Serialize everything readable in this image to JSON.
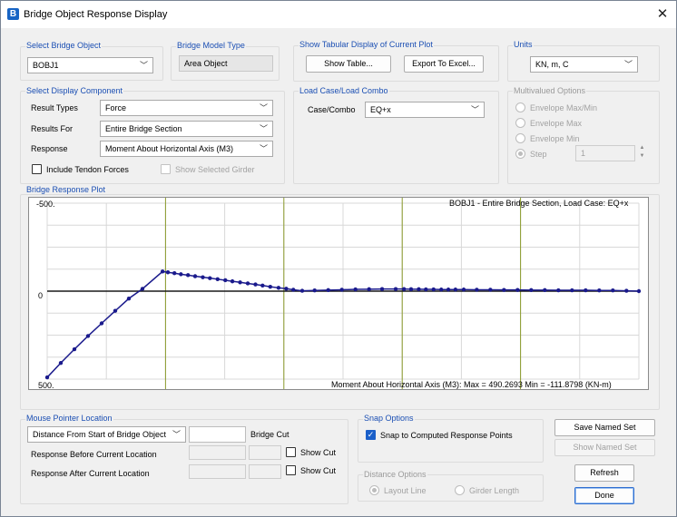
{
  "window": {
    "title": "Bridge Object Response Display",
    "app_icon": "B",
    "close_icon": "✕"
  },
  "select_bridge_object": {
    "label": "Select Bridge Object",
    "value": "BOBJ1"
  },
  "bridge_model_type": {
    "label": "Bridge Model Type",
    "value": "Area Object"
  },
  "tabular": {
    "label": "Show Tabular Display of Current Plot",
    "show_table": "Show Table...",
    "export_excel": "Export To Excel..."
  },
  "units": {
    "label": "Units",
    "value": "KN, m, C"
  },
  "display_component": {
    "label": "Select Display Component",
    "result_types_label": "Result Types",
    "result_types_value": "Force",
    "results_for_label": "Results For",
    "results_for_value": "Entire Bridge Section",
    "response_label": "Response",
    "response_value": "Moment About Horizontal Axis  (M3)",
    "include_tendon": "Include Tendon Forces",
    "show_selected_girder": "Show Selected Girder"
  },
  "load_case": {
    "label": "Load Case/Load Combo",
    "case_label": "Case/Combo",
    "case_value": "EQ+x"
  },
  "multivalued": {
    "label": "Multivalued Options",
    "env_maxmin": "Envelope Max/Min",
    "env_max": "Envelope Max",
    "env_min": "Envelope Min",
    "step": "Step",
    "step_value": "1"
  },
  "plot": {
    "label": "Bridge Response Plot",
    "header": "BOBJ1 - Entire Bridge Section,  Load Case: EQ+x",
    "footer": "Moment About Horizontal Axis  (M3):  Max = 490.2693    Min = -111.8798  (KN-m)",
    "y_top": "-500.",
    "y_zero": "0",
    "y_bottom": "500."
  },
  "chart_data": {
    "type": "line",
    "title": "BOBJ1 - Entire Bridge Section,  Load Case: EQ+x",
    "xlabel": "",
    "ylabel": "",
    "ylim": [
      500,
      -500
    ],
    "xlim": [
      0,
      100
    ],
    "grid": true,
    "series": [
      {
        "color": "#1a1a8c",
        "x": [
          0,
          2.3,
          4.6,
          6.9,
          9.2,
          11.5,
          13.8,
          16.1,
          19.5,
          20.4,
          21.5,
          22.6,
          23.8,
          25,
          26.3,
          27.5,
          28.8,
          30.1,
          31.3,
          32.6,
          33.9,
          35.2,
          36.4,
          37.7,
          39.1,
          40.4,
          41.6,
          43.1,
          45.2,
          47.5,
          49.8,
          52.1,
          54.4,
          56.6,
          58.9,
          60.3,
          61.5,
          62.8,
          64,
          65.3,
          66.6,
          67.8,
          69,
          70.4,
          72.6,
          74.9,
          77.2,
          79.5,
          81.8,
          84.1,
          86.4,
          88.7,
          91,
          93.3,
          95.6,
          97.9,
          100
        ],
        "values": [
          490,
          408,
          330,
          255,
          183,
          112,
          42,
          -13,
          -112,
          -107,
          -102,
          -96,
          -91,
          -85,
          -79,
          -74,
          -68,
          -62,
          -56,
          -50,
          -44,
          -38,
          -32,
          -25,
          -19,
          -14,
          -8,
          -2,
          -4,
          -6,
          -8,
          -10,
          -11,
          -12,
          -12,
          -12,
          -11,
          -11,
          -10,
          -10,
          -9,
          -9,
          -9,
          -9,
          -8,
          -8,
          -7,
          -7,
          -6,
          -6,
          -5,
          -5,
          -5,
          -4,
          -4,
          -2,
          0
        ]
      }
    ]
  },
  "mouse_pointer": {
    "label": "Mouse Pointer Location",
    "combo_value": "Distance From Start of Bridge Object",
    "bridge_cut": "Bridge Cut",
    "before_label": "Response Before Current Location",
    "after_label": "Response After Current Location",
    "show_cut": "Show Cut"
  },
  "snap": {
    "label": "Snap Options",
    "snap_label": "Snap to Computed Response Points"
  },
  "distance": {
    "label": "Distance Options",
    "layout_line": "Layout Line",
    "girder_length": "Girder Length"
  },
  "buttons": {
    "save_named_set": "Save Named Set",
    "show_named_set": "Show Named Set",
    "refresh": "Refresh",
    "done": "Done"
  }
}
